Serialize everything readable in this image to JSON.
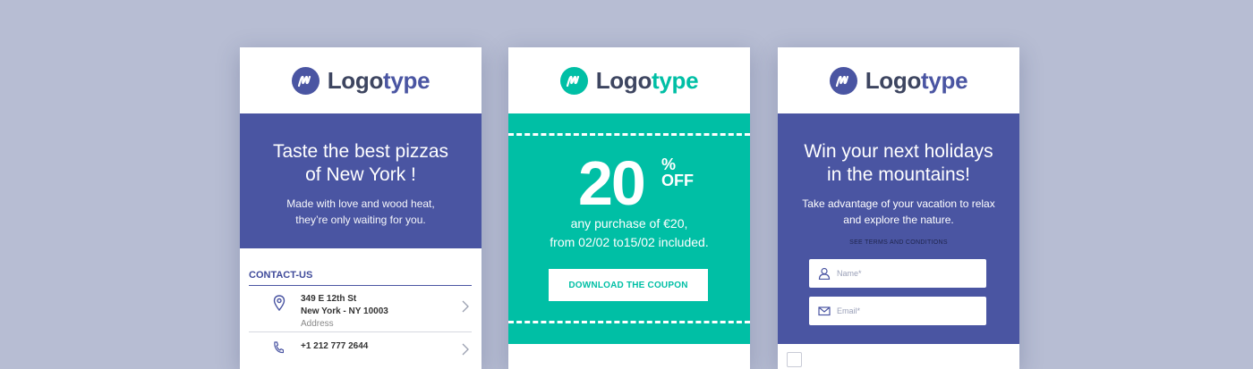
{
  "colors": {
    "background": "#b7bdd3",
    "brand_blue": "#4a55a2",
    "brand_green": "#00bfa5",
    "logo_dark": "#3d4560"
  },
  "cards": [
    {
      "logo": {
        "part1": "Logo",
        "part2": "type",
        "accent": "#4a55a2",
        "icon": "m-monogram-icon"
      },
      "hero_title_line1": "Taste the best pizzas",
      "hero_title_line2": "of New York !",
      "hero_sub_line1": "Made with love and wood heat,",
      "hero_sub_line2": "they’re only waiting for you.",
      "contact_heading": "CONTACT-US",
      "address": {
        "line1": "349 E 12th St",
        "line2": "New York - NY 10003",
        "label": "Address",
        "icon": "location-pin-icon"
      },
      "phone": {
        "value": "+1 212 777 2644",
        "icon": "phone-icon"
      }
    },
    {
      "logo": {
        "part1": "Logo",
        "part2": "type",
        "accent": "#00bfa5",
        "icon": "m-monogram-icon"
      },
      "discount_number": "20",
      "percent_sign": "%",
      "off_label": "OFF",
      "offer_line1": "any purchase of €20,",
      "offer_line2": "from 02/02 to15/02 included.",
      "button_label": "DOWNLOAD THE COUPON"
    },
    {
      "logo": {
        "part1": "Logo",
        "part2": "type",
        "accent": "#4a55a2",
        "icon": "m-monogram-icon"
      },
      "hero_title_line1": "Win your next holidays",
      "hero_title_line2": "in the mountains!",
      "hero_sub_line1": "Take advantage of your vacation to relax",
      "hero_sub_line2": "and explore the nature.",
      "terms_link": "SEE TERMS AND CONDITIONS",
      "name_placeholder": "Name*",
      "email_placeholder": "Email*"
    }
  ]
}
